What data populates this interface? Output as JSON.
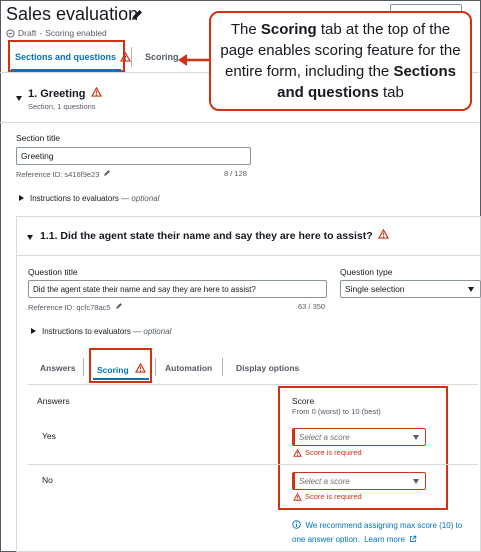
{
  "header": {
    "title": "Sales evaluation",
    "status_draft": "Draft",
    "status_separator": "-",
    "status_scoring": "Scoring enabled"
  },
  "top_tabs": {
    "sections": "Sections and questions",
    "scoring": "Scoring"
  },
  "callout": {
    "part1": "The ",
    "bold1": "Scoring",
    "part2": " tab at the top of the page enables scoring feature for the entire form, including the ",
    "bold2": "Sections and questions",
    "part3": " tab"
  },
  "section": {
    "title": "1. Greeting",
    "subtitle": "Section, 1 questions",
    "title_label": "Section title",
    "title_value": "Greeting",
    "reference": "Reference ID: s416f9e23",
    "char_count": "8 / 128",
    "instructions_label": "Instructions to evaluators",
    "instructions_optional": "— optional"
  },
  "question": {
    "title": "1.1. Did the agent state their name and say they are here to assist?",
    "title_label": "Question title",
    "title_value": "Did the agent state their name and say they are here to assist?",
    "reference": "Reference ID: qcfc78ac5",
    "char_count": "63 / 350",
    "type_label": "Question type",
    "type_value": "Single selection",
    "instructions_label": "Instructions to evaluators",
    "instructions_optional": "— optional"
  },
  "inner_tabs": {
    "answers": "Answers",
    "scoring": "Scoring",
    "automation": "Automation",
    "display": "Display options"
  },
  "scoring_panel": {
    "answers_header": "Answers",
    "score_header": "Score",
    "score_range": "From 0 (worst) to 10 (best)",
    "rows": [
      {
        "answer": "Yes",
        "placeholder": "Select a score",
        "error": "Score is required"
      },
      {
        "answer": "No",
        "placeholder": "Select a score",
        "error": "Score is required"
      }
    ],
    "recommend_text": "We recommend assigning max score (10) to one answer option.",
    "learn_more": "Learn more"
  },
  "colors": {
    "accent": "#0073bb",
    "error": "#d13212",
    "text": "#16191f",
    "muted": "#545b64"
  }
}
